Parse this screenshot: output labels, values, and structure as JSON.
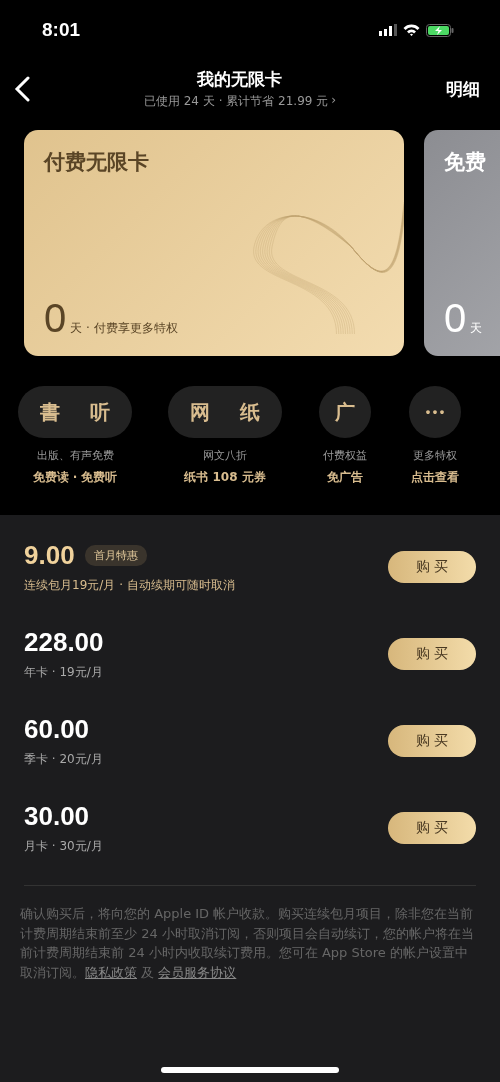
{
  "status_bar": {
    "time": "8:01"
  },
  "nav": {
    "title": "我的无限卡",
    "subtitle": "已使用 24 天 · 累计节省 21.99 元",
    "subtitle_arrow": "›",
    "action": "明细"
  },
  "cards": [
    {
      "kind": "paid",
      "title": "付费无限卡",
      "days": "0",
      "caption": "天 · 付费享更多特权"
    },
    {
      "kind": "free",
      "title": "免费",
      "days": "0",
      "caption": "天"
    }
  ],
  "perks": [
    {
      "icon_text": "書 听",
      "label": "出版、有声免费",
      "value": "免费读 · 免费听"
    },
    {
      "icon_text": "网 纸",
      "label": "网文八折",
      "value": "纸书 108 元券"
    },
    {
      "icon_text": "广",
      "label": "付费权益",
      "value": "免广告"
    },
    {
      "icon_text": "···",
      "label": "更多特权",
      "value": "点击查看"
    }
  ],
  "plans": [
    {
      "kind": "promo",
      "price": "9.00",
      "badge": "首月特惠",
      "description": "连续包月19元/月 · 自动续期可随时取消",
      "button": "购 买"
    },
    {
      "kind": "standard",
      "price": "228.00",
      "description": "年卡 · 19元/月",
      "button": "购 买"
    },
    {
      "kind": "standard",
      "price": "60.00",
      "description": "季卡 · 20元/月",
      "button": "购 买"
    },
    {
      "kind": "standard",
      "price": "30.00",
      "description": "月卡 · 30元/月",
      "button": "购 买"
    }
  ],
  "legal": {
    "text": "确认购买后，将向您的 Apple ID 帐户收款。购买连续包月项目，除非您在当前计费周期结束前至少 24 小时取消订阅，否则项目会自动续订，您的帐户将在当前计费周期结束前 24 小时内收取续订费用。您可在 App Store 的帐户设置中取消订阅。",
    "privacy_link": "隐私政策",
    "joiner": "及",
    "agreement_link": "会员服务协议"
  }
}
